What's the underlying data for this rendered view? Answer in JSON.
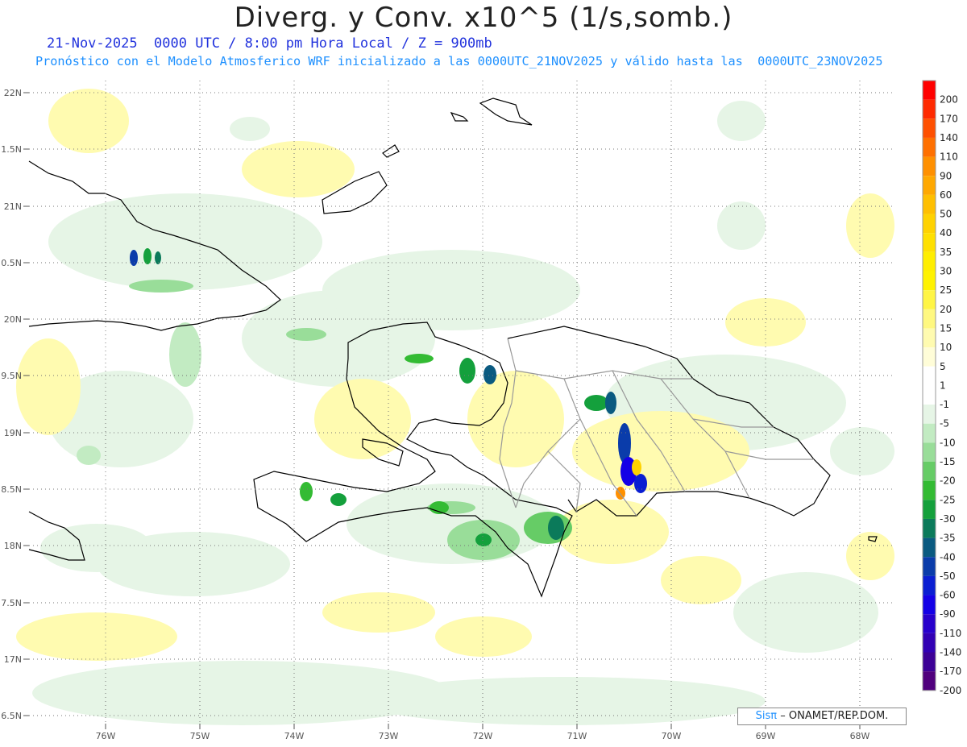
{
  "title": "Diverg. y Conv. x10^5 (1/s,somb.)",
  "subtitle_date": "21-Nov-2025  0000 UTC / 8:00 pm Hora Local / Z = 900mb",
  "subtitle_model": "Pronóstico con el Modelo Atmosferico WRF inicializado a las 0000UTC_21NOV2025 y válido hasta las  0000UTC_23NOV2025",
  "credit": {
    "logo": "Sisπ",
    "org": "– ONAMET/REP.DOM."
  },
  "axes": {
    "lat_labels": [
      "22N",
      "1.5N",
      "21N",
      "0.5N",
      "20N",
      "9.5N",
      "19N",
      "8.5N",
      "18N",
      "7.5N",
      "17N",
      "6.5N"
    ],
    "lon_labels": [
      "76W",
      "75W",
      "74W",
      "73W",
      "72W",
      "71W",
      "70W",
      "69W",
      "68W"
    ]
  },
  "colorbar": {
    "labels": [
      "200",
      "170",
      "140",
      "110",
      "90",
      "60",
      "50",
      "40",
      "35",
      "30",
      "25",
      "20",
      "15",
      "10",
      "5",
      "1",
      "-1",
      "-5",
      "-10",
      "-15",
      "-20",
      "-25",
      "-30",
      "-35",
      "-40",
      "-50",
      "-60",
      "-90",
      "-110",
      "-140",
      "-170",
      "-200"
    ],
    "colors": [
      "#ff0000",
      "#ff2a00",
      "#ff5000",
      "#ff7000",
      "#ff9000",
      "#ffa800",
      "#ffbf00",
      "#ffd200",
      "#ffe000",
      "#ffee00",
      "#fff200",
      "#fff545",
      "#fff880",
      "#fffbb0",
      "#fffdd8",
      "#ffffff",
      "#ffffff",
      "#e6f5e6",
      "#c2ebc2",
      "#99dd99",
      "#66cc66",
      "#33bb33",
      "#14a03c",
      "#0b7a5a",
      "#0a5a80",
      "#0a3caa",
      "#0a1ed2",
      "#1400e6",
      "#2800cc",
      "#3200b4",
      "#3c0096",
      "#50007d"
    ]
  }
}
